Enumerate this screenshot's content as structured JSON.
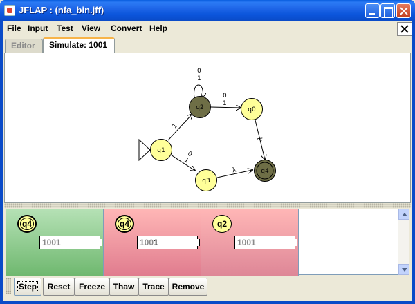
{
  "window": {
    "title": "JFLAP : (nfa_bin.jff)"
  },
  "menu": {
    "items": [
      "File",
      "Input",
      "Test",
      "View",
      "Convert",
      "Help"
    ]
  },
  "tabs": {
    "editor": "Editor",
    "simulate": "Simulate: 1001",
    "active": "simulate"
  },
  "automaton": {
    "states": [
      {
        "id": "q0",
        "label": "q0",
        "initial": false,
        "final": false,
        "highlighted": false
      },
      {
        "id": "q1",
        "label": "q1",
        "initial": true,
        "final": false,
        "highlighted": false
      },
      {
        "id": "q2",
        "label": "q2",
        "initial": false,
        "final": false,
        "highlighted": true
      },
      {
        "id": "q3",
        "label": "q3",
        "initial": false,
        "final": false,
        "highlighted": false
      },
      {
        "id": "q4",
        "label": "q4",
        "initial": false,
        "final": true,
        "highlighted": true
      }
    ],
    "transitions": [
      {
        "from": "q2",
        "to": "q2",
        "labels": [
          "0",
          "1"
        ]
      },
      {
        "from": "q2",
        "to": "q0",
        "labels": [
          "0",
          "1"
        ]
      },
      {
        "from": "q1",
        "to": "q2",
        "labels": [
          "1"
        ]
      },
      {
        "from": "q1",
        "to": "q3",
        "labels": [
          "0",
          "1"
        ]
      },
      {
        "from": "q0",
        "to": "q4",
        "labels": [
          "λ"
        ]
      },
      {
        "from": "q3",
        "to": "q4",
        "labels": [
          "λ"
        ]
      }
    ],
    "colors": {
      "state_fill": "#FFFF99",
      "highlight_fill": "#6E6E46"
    }
  },
  "configurations": [
    {
      "state": "q4",
      "final": true,
      "status": "accepted",
      "color": "#8FCB8F",
      "input_consumed": "1001",
      "input_remaining": ""
    },
    {
      "state": "q4",
      "final": true,
      "status": "rejected",
      "color": "#F0A0AA",
      "input_consumed": "100",
      "input_remaining": "1"
    },
    {
      "state": "q2",
      "final": false,
      "status": "rejected",
      "color": "#F0A0AA",
      "input_consumed": "1001",
      "input_remaining": ""
    }
  ],
  "toolbar": {
    "step": "Step",
    "reset": "Reset",
    "freeze": "Freeze",
    "thaw": "Thaw",
    "trace": "Trace",
    "remove": "Remove"
  }
}
